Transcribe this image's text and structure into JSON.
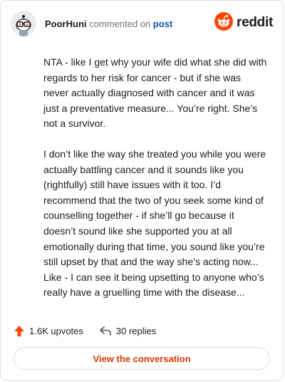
{
  "header": {
    "username": "PoorHuni",
    "action_text": "commented on",
    "post_link": "post",
    "brand": "reddit",
    "avatar_icon": "snoo-avatar-icon",
    "brand_icon": "reddit-logo-icon"
  },
  "comment": {
    "paragraphs": [
      "NTA - like I get why your wife did what she did with regards to her risk for cancer - but if she was never actually diagnosed with cancer and it was just a preventative measure... You’re right. She’s not a survivor.",
      "I don’t like the way she treated you while you were actually battling cancer and it sounds like you (rightfully) still have issues with it too. I’d recommend that the two of you seek some kind of counselling together - if she’ll go because it doesn’t sound like she supported you at all emotionally during that time, you sound like you’re still upset by that and the way she’s acting now... Like - I can see it being upsetting to anyone who’s really have a gruelling time with the disease..."
    ]
  },
  "stats": {
    "upvotes": "1.6K upvotes",
    "replies": "30 replies",
    "upvote_icon": "upvote-arrow-icon",
    "reply_icon": "reply-arrow-icon"
  },
  "cta": {
    "label": "View the conversation"
  },
  "colors": {
    "accent": "#d93a00",
    "brand": "#ff4500",
    "link": "#0a53a8"
  }
}
